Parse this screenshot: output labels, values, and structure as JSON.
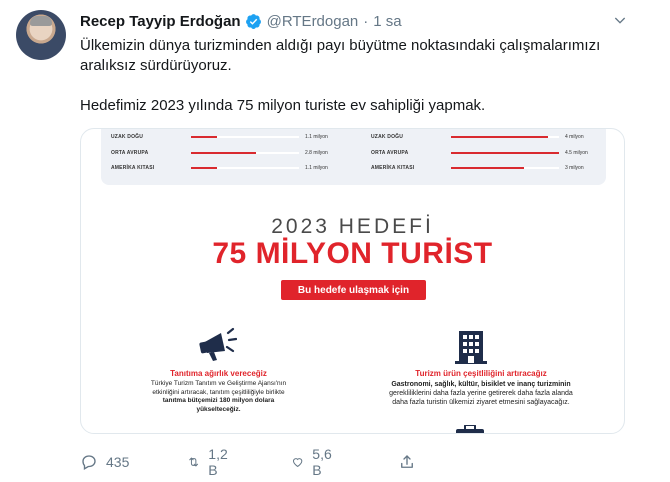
{
  "tweet": {
    "author_name": "Recep Tayyip Erdoğan",
    "handle": "@RTErdogan",
    "separator": "·",
    "time": "1 sa",
    "line1": "Ülkemizin dünya turizminden aldığı payı büyütme noktasındaki çalışmalarımızı",
    "line2": "aralıksız sürdürüyoruz.",
    "line3": "Hedefimiz 2023 yılında 75 milyon turiste ev sahipliği yapmak."
  },
  "infographic": {
    "bars_left": [
      {
        "label": "UZAK DOĞU",
        "value": "1.1 milyon",
        "fill": 0.24
      },
      {
        "label": "ORTA AVRUPA",
        "value": "2.8 milyon",
        "fill": 0.6
      },
      {
        "label": "AMERİKA KITASI",
        "value": "1.1 milyon",
        "fill": 0.24
      }
    ],
    "bars_right": [
      {
        "label": "UZAK DOĞU",
        "value": "4 milyon",
        "fill": 0.9
      },
      {
        "label": "ORTA AVRUPA",
        "value": "4.5 milyon",
        "fill": 1.0
      },
      {
        "label": "AMERİKA KITASI",
        "value": "3 milyon",
        "fill": 0.68
      }
    ],
    "heading": "2023 HEDEFİ",
    "big_title": "75 MİLYON TURİST",
    "red_button": "Bu hedefe ulaşmak için",
    "left_title": "Tanıtıma ağırlık vereceğiz",
    "left_body_1": "Türkiye Turizm Tanıtım ve Geliştirme Ajansı'nın",
    "left_body_2": "etkinliğini artıracak, tanıtım çeşitliliğiyle birlikte",
    "left_body_3": "tanıtma bütçemizi 180 milyon dolara",
    "left_body_4": "yükselteceğiz.",
    "right_title": "Turizm ürün çeşitliliğini artıracağız",
    "right_body_1": "Gastronomi, sağlık, kültür, bisiklet ve inanç turizminin",
    "right_body_2": "gerekliliklerini daha fazla yerine getirerek daha fazla alanda",
    "right_body_3": "daha fazla turistin ülkemizi ziyaret etmesini sağlayacağız.",
    "accent_color": "#e0242b"
  },
  "actions": {
    "reply_icon": "reply-icon",
    "reply_count": "435",
    "retweet_icon": "retweet-icon",
    "retweet_count": "1,2 B",
    "like_icon": "heart-icon",
    "like_count": "5,6 B",
    "share_icon": "share-icon"
  }
}
